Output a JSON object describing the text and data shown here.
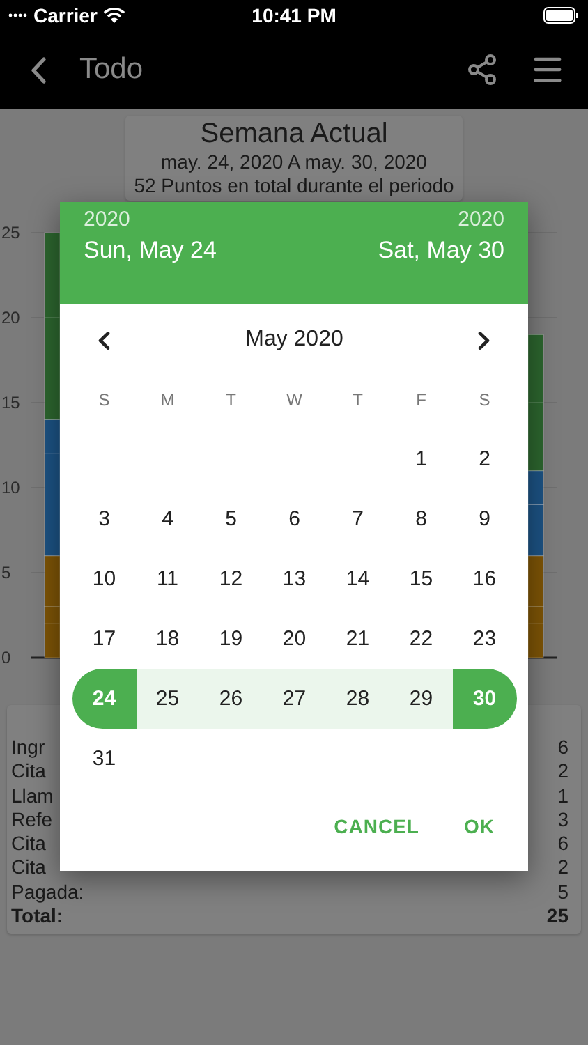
{
  "status_bar": {
    "carrier": "Carrier",
    "time": "10:41 PM"
  },
  "nav_bar": {
    "title": "Todo"
  },
  "period_card": {
    "title": "Semana Actual",
    "range": "may. 24, 2020 A may. 30, 2020",
    "total": "52 Puntos en total durante el periodo"
  },
  "chart": {
    "chart_data": {
      "type": "bar",
      "stacked": true,
      "grid": true,
      "ylim": [
        0,
        25
      ],
      "yticks": [
        0,
        5,
        10,
        15,
        20,
        25
      ],
      "series": [
        {
          "color": "#7d5406",
          "values": [
            2,
            2
          ]
        },
        {
          "color": "#7d5406",
          "values": [
            1,
            1
          ]
        },
        {
          "color": "#7d5406",
          "values": [
            3,
            3
          ]
        },
        {
          "color": "#1c5283",
          "values": [
            6,
            3
          ]
        },
        {
          "color": "#1c5283",
          "values": [
            2,
            2
          ]
        },
        {
          "color": "#2c652e",
          "values": [
            6,
            4
          ]
        },
        {
          "color": "#2c652e",
          "values": [
            5,
            4
          ]
        }
      ]
    }
  },
  "summary": {
    "rows": [
      {
        "label": "Ingr",
        "value": "6"
      },
      {
        "label": "Cita",
        "value": "2"
      },
      {
        "label": "Llam",
        "value": "1"
      },
      {
        "label": "Refe",
        "value": "3"
      },
      {
        "label": "Cita",
        "value": "6"
      },
      {
        "label": "Cita",
        "value": "2"
      },
      {
        "label": "Pagada:",
        "value": "5"
      }
    ],
    "total": {
      "label": "Total:",
      "value": "25"
    }
  },
  "date_picker": {
    "start": {
      "year": "2020",
      "date": "Sun, May 24"
    },
    "end": {
      "year": "2020",
      "date": "Sat, May 30"
    },
    "month": "May 2020",
    "weekdays": [
      "S",
      "M",
      "T",
      "W",
      "T",
      "F",
      "S"
    ],
    "weeks": [
      [
        {
          "kind": "blank"
        },
        {
          "kind": "blank"
        },
        {
          "kind": "blank"
        },
        {
          "kind": "blank"
        },
        {
          "kind": "blank"
        },
        {
          "kind": "day",
          "day": "1",
          "selected": false,
          "in_range": false
        },
        {
          "kind": "day",
          "day": "2",
          "selected": false,
          "in_range": false
        }
      ],
      [
        {
          "kind": "day",
          "day": "3",
          "selected": false,
          "in_range": false
        },
        {
          "kind": "day",
          "day": "4",
          "selected": false,
          "in_range": false
        },
        {
          "kind": "day",
          "day": "5",
          "selected": false,
          "in_range": false
        },
        {
          "kind": "day",
          "day": "6",
          "selected": false,
          "in_range": false
        },
        {
          "kind": "day",
          "day": "7",
          "selected": false,
          "in_range": false
        },
        {
          "kind": "day",
          "day": "8",
          "selected": false,
          "in_range": false
        },
        {
          "kind": "day",
          "day": "9",
          "selected": false,
          "in_range": false
        }
      ],
      [
        {
          "kind": "day",
          "day": "10",
          "selected": false,
          "in_range": false
        },
        {
          "kind": "day",
          "day": "11",
          "selected": false,
          "in_range": false
        },
        {
          "kind": "day",
          "day": "12",
          "selected": false,
          "in_range": false
        },
        {
          "kind": "day",
          "day": "13",
          "selected": false,
          "in_range": false
        },
        {
          "kind": "day",
          "day": "14",
          "selected": false,
          "in_range": false
        },
        {
          "kind": "day",
          "day": "15",
          "selected": false,
          "in_range": false
        },
        {
          "kind": "day",
          "day": "16",
          "selected": false,
          "in_range": false
        }
      ],
      [
        {
          "kind": "day",
          "day": "17",
          "selected": false,
          "in_range": false
        },
        {
          "kind": "day",
          "day": "18",
          "selected": false,
          "in_range": false
        },
        {
          "kind": "day",
          "day": "19",
          "selected": false,
          "in_range": false
        },
        {
          "kind": "day",
          "day": "20",
          "selected": false,
          "in_range": false
        },
        {
          "kind": "day",
          "day": "21",
          "selected": false,
          "in_range": false
        },
        {
          "kind": "day",
          "day": "22",
          "selected": false,
          "in_range": false
        },
        {
          "kind": "day",
          "day": "23",
          "selected": false,
          "in_range": false
        }
      ],
      [
        {
          "kind": "day",
          "day": "24",
          "selected": true,
          "in_range": true
        },
        {
          "kind": "day",
          "day": "25",
          "selected": false,
          "in_range": true
        },
        {
          "kind": "day",
          "day": "26",
          "selected": false,
          "in_range": true
        },
        {
          "kind": "day",
          "day": "27",
          "selected": false,
          "in_range": true
        },
        {
          "kind": "day",
          "day": "28",
          "selected": false,
          "in_range": true
        },
        {
          "kind": "day",
          "day": "29",
          "selected": false,
          "in_range": true
        },
        {
          "kind": "day",
          "day": "30",
          "selected": true,
          "in_range": true
        }
      ],
      [
        {
          "kind": "day",
          "day": "31",
          "selected": false,
          "in_range": false
        }
      ]
    ],
    "buttons": [
      "CANCEL",
      "OK"
    ]
  }
}
